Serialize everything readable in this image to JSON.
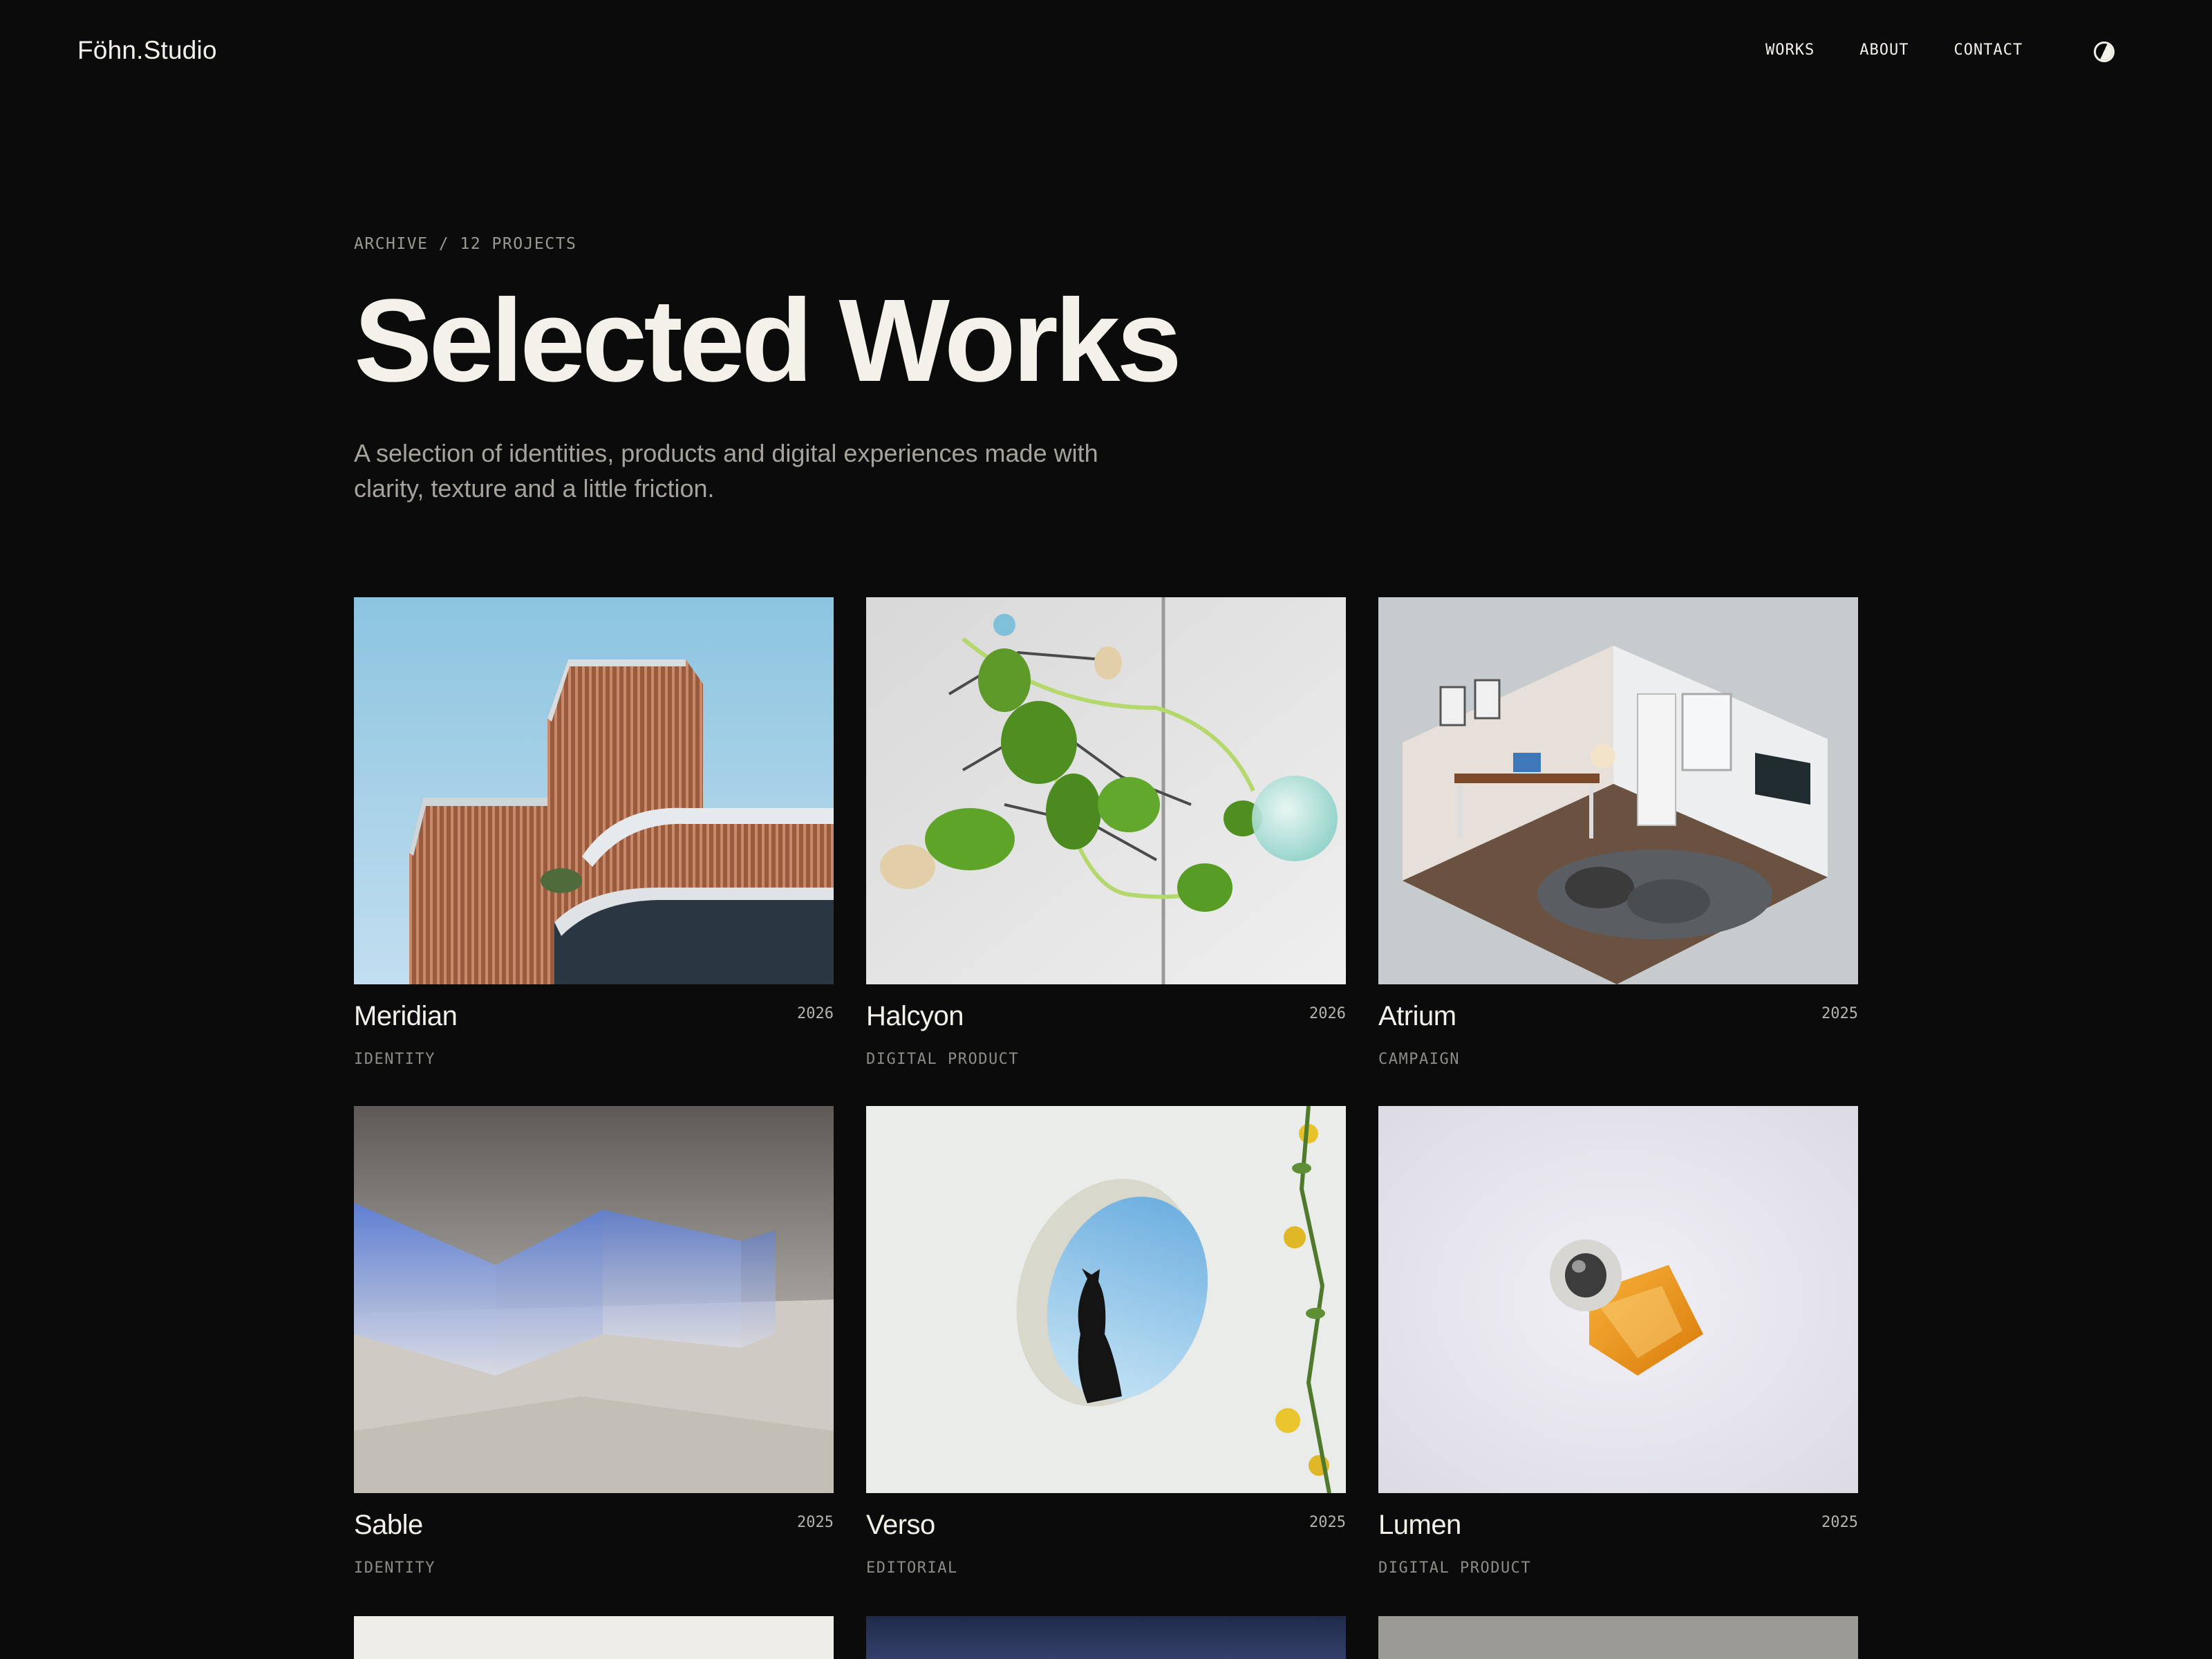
{
  "brand": {
    "logo": "Föhn.Studio"
  },
  "nav": {
    "items": [
      "WORKS",
      "ABOUT",
      "CONTACT"
    ],
    "theme_toggle_icon": "contrast-icon"
  },
  "hero": {
    "eyebrow": "ARCHIVE / 12 PROJECTS",
    "title": "Selected Works",
    "lede": "A selection of identities, products and digital experiences made with clarity, texture and a little friction."
  },
  "projects": [
    {
      "title": "Meridian",
      "year": "2026",
      "category": "IDENTITY"
    },
    {
      "title": "Halcyon",
      "year": "2026",
      "category": "DIGITAL PRODUCT"
    },
    {
      "title": "Atrium",
      "year": "2025",
      "category": "CAMPAIGN"
    },
    {
      "title": "Sable",
      "year": "2025",
      "category": "IDENTITY"
    },
    {
      "title": "Verso",
      "year": "2025",
      "category": "EDITORIAL"
    },
    {
      "title": "Lumen",
      "year": "2025",
      "category": "DIGITAL PRODUCT"
    }
  ],
  "colors": {
    "background": "#0b0b0b",
    "text": "#f3f1ea",
    "muted": "#9a9a94"
  }
}
